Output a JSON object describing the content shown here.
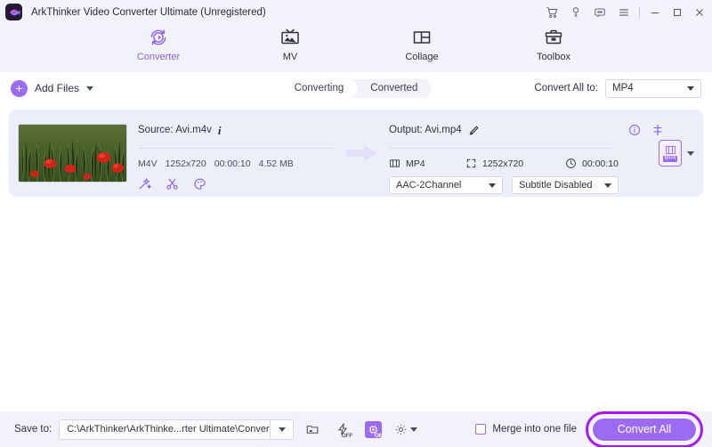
{
  "window": {
    "title": "ArkThinker Video Converter Ultimate (Unregistered)",
    "logo_icon": "arkthinker-logo-icon",
    "controls": [
      {
        "name": "cart-icon",
        "glyph": "cart"
      },
      {
        "name": "key-icon",
        "glyph": "key"
      },
      {
        "name": "feedback-icon",
        "glyph": "message"
      },
      {
        "name": "menu-icon",
        "glyph": "hamburger"
      },
      {
        "name": "minimize-button",
        "glyph": "minimize"
      },
      {
        "name": "maximize-button",
        "glyph": "maximize"
      },
      {
        "name": "close-button",
        "glyph": "close"
      }
    ]
  },
  "nav": {
    "tabs": [
      {
        "label": "Converter",
        "icon": "converter-icon",
        "active": true
      },
      {
        "label": "MV",
        "icon": "mv-icon",
        "active": false
      },
      {
        "label": "Collage",
        "icon": "collage-icon",
        "active": false
      },
      {
        "label": "Toolbox",
        "icon": "toolbox-icon",
        "active": false
      }
    ]
  },
  "toolbar": {
    "add_files_label": "Add Files",
    "segments": [
      {
        "label": "Converting",
        "active": true
      },
      {
        "label": "Converted",
        "active": false
      }
    ],
    "convert_all_to_label": "Convert All to:",
    "convert_all_to_value": "MP4"
  },
  "file": {
    "thumbnail_alt": "poppy-field-thumbnail",
    "source_label": "Source: Avi.m4v",
    "source_format": "M4V",
    "source_resolution": "1252x720",
    "source_duration": "00:00:10",
    "source_size": "4.52 MB",
    "edit_tools": [
      {
        "name": "magic-wand-icon",
        "label": "Enhance"
      },
      {
        "name": "scissors-icon",
        "label": "Trim"
      },
      {
        "name": "palette-icon",
        "label": "Edit"
      }
    ],
    "output_label": "Output: Avi.mp4",
    "output_format": "MP4",
    "output_resolution": "1252x720",
    "output_duration": "00:00:10",
    "audio_track": "AAC-2Channel",
    "subtitle_track": "Subtitle Disabled",
    "format_badge": "MP4"
  },
  "bottom": {
    "save_to_label": "Save to:",
    "save_to_path": "C:\\ArkThinker\\ArkThinke...rter Ultimate\\Converted",
    "open_folder_icon": "folder-icon",
    "hw_accel_label": "OFF",
    "gpu_accel_label": "ON",
    "settings_icon": "gear-icon",
    "merge_label": "Merge into one file",
    "merge_checked": false,
    "convert_all_label": "Convert All"
  },
  "colors": {
    "accent": "#9b6cf2",
    "highlight_ring": "#a818f0",
    "header_bg": "#f1f2fa",
    "card_bg": "#eceffa"
  }
}
